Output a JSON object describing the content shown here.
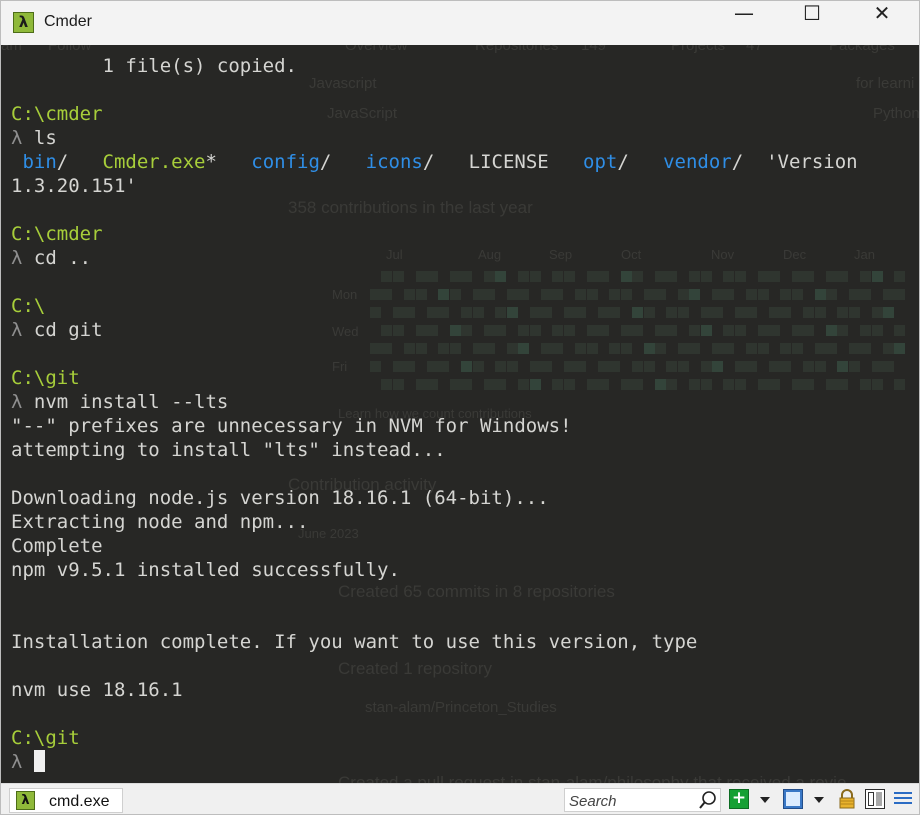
{
  "window": {
    "title": "Cmder",
    "minimize_glyph": "—",
    "maximize_glyph": "☐",
    "close_glyph": "✕"
  },
  "ghost_overlay": {
    "header": [
      "am",
      "Follow",
      "Overview",
      "Repositories",
      "149",
      "Projects",
      "47",
      "Packages"
    ],
    "pins": [
      "Javascript",
      "JavaScript",
      "for learni",
      "Python"
    ],
    "contributions_title": "358 contributions in the last year",
    "months": [
      "Jul",
      "Aug",
      "Sep",
      "Oct",
      "Nov",
      "Dec",
      "Jan"
    ],
    "days": [
      "Mon",
      "Wed",
      "Fri"
    ],
    "learn_link": "Learn how we count contributions",
    "activity_title": "Contribution activity",
    "activity_month": "June 2023",
    "activity_items": [
      "Created 65 commits in 8 repositories",
      "Created 1 repository",
      "stan-alam/Princeton_Studies",
      "Created a pull request in stan-alam/philosophy that received a revie"
    ]
  },
  "terminal": {
    "lines": [
      [
        {
          "t": "        1 file(s) copied.",
          "c": "plain"
        }
      ],
      [],
      [
        {
          "t": "C:\\cmder",
          "c": "green"
        }
      ],
      [
        {
          "t": "λ ",
          "c": "prompt"
        },
        {
          "t": "ls",
          "c": "plain"
        }
      ],
      [
        {
          "t": " bin",
          "c": "blue"
        },
        {
          "t": "/   ",
          "c": "plain"
        },
        {
          "t": "Cmder.exe",
          "c": "green"
        },
        {
          "t": "*   ",
          "c": "plain"
        },
        {
          "t": "config",
          "c": "blue"
        },
        {
          "t": "/   ",
          "c": "plain"
        },
        {
          "t": "icons",
          "c": "blue"
        },
        {
          "t": "/   ",
          "c": "plain"
        },
        {
          "t": "LICENSE   ",
          "c": "plain"
        },
        {
          "t": "opt",
          "c": "blue"
        },
        {
          "t": "/   ",
          "c": "plain"
        },
        {
          "t": "vendor",
          "c": "blue"
        },
        {
          "t": "/  'Version",
          "c": "plain"
        }
      ],
      [
        {
          "t": "1.3.20.151'",
          "c": "plain"
        }
      ],
      [],
      [
        {
          "t": "C:\\cmder",
          "c": "green"
        }
      ],
      [
        {
          "t": "λ ",
          "c": "prompt"
        },
        {
          "t": "cd ..",
          "c": "plain"
        }
      ],
      [],
      [
        {
          "t": "C:\\",
          "c": "green"
        }
      ],
      [
        {
          "t": "λ ",
          "c": "prompt"
        },
        {
          "t": "cd git",
          "c": "plain"
        }
      ],
      [],
      [
        {
          "t": "C:\\git",
          "c": "green"
        }
      ],
      [
        {
          "t": "λ ",
          "c": "prompt"
        },
        {
          "t": "nvm install --lts",
          "c": "plain"
        }
      ],
      [
        {
          "t": "\"--\" prefixes are unnecessary in NVM for Windows!",
          "c": "plain"
        }
      ],
      [
        {
          "t": "attempting to install \"lts\" instead...",
          "c": "plain"
        }
      ],
      [],
      [
        {
          "t": "Downloading node.js version 18.16.1 (64-bit)...",
          "c": "plain"
        }
      ],
      [
        {
          "t": "Extracting node and npm...",
          "c": "plain"
        }
      ],
      [
        {
          "t": "Complete",
          "c": "plain"
        }
      ],
      [
        {
          "t": "npm v9.5.1 installed successfully.",
          "c": "plain"
        }
      ],
      [],
      [],
      [
        {
          "t": "Installation complete. If you want to use this version, type",
          "c": "plain"
        }
      ],
      [],
      [
        {
          "t": "nvm use 18.16.1",
          "c": "plain"
        }
      ],
      [],
      [
        {
          "t": "C:\\git",
          "c": "green"
        }
      ],
      [
        {
          "t": "λ ",
          "c": "prompt"
        }
      ]
    ]
  },
  "statusbar": {
    "tab_icon": "λ",
    "tab_label": "cmd.exe",
    "search_placeholder": "Search"
  },
  "colors": {
    "green": "#a7ce3a",
    "blue": "#2f8ee6",
    "text": "#d5d5d2",
    "background": "#272725"
  }
}
